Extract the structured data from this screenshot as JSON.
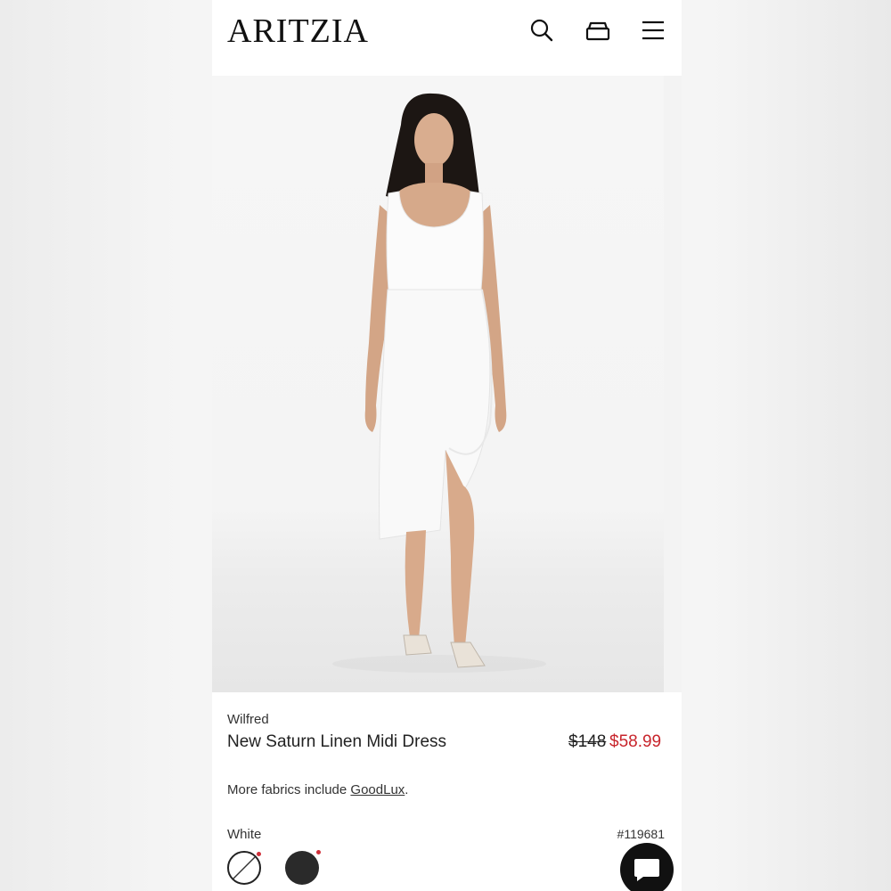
{
  "header": {
    "logo": "ARITZIA",
    "icons": [
      "search-icon",
      "bag-icon",
      "menu-icon"
    ]
  },
  "product": {
    "brand": "Wilfred",
    "name": "New Saturn Linen Midi Dress",
    "price_original": "$148",
    "price_sale": "$58.99",
    "fabrics_prefix": "More fabrics include ",
    "fabrics_link": "GoodLux",
    "fabrics_suffix": ".",
    "color_name": "White",
    "sku": "#119681",
    "swatches": [
      "white",
      "black"
    ]
  },
  "colors": {
    "sale_red": "#c8252c",
    "text": "#1a1a1a"
  }
}
